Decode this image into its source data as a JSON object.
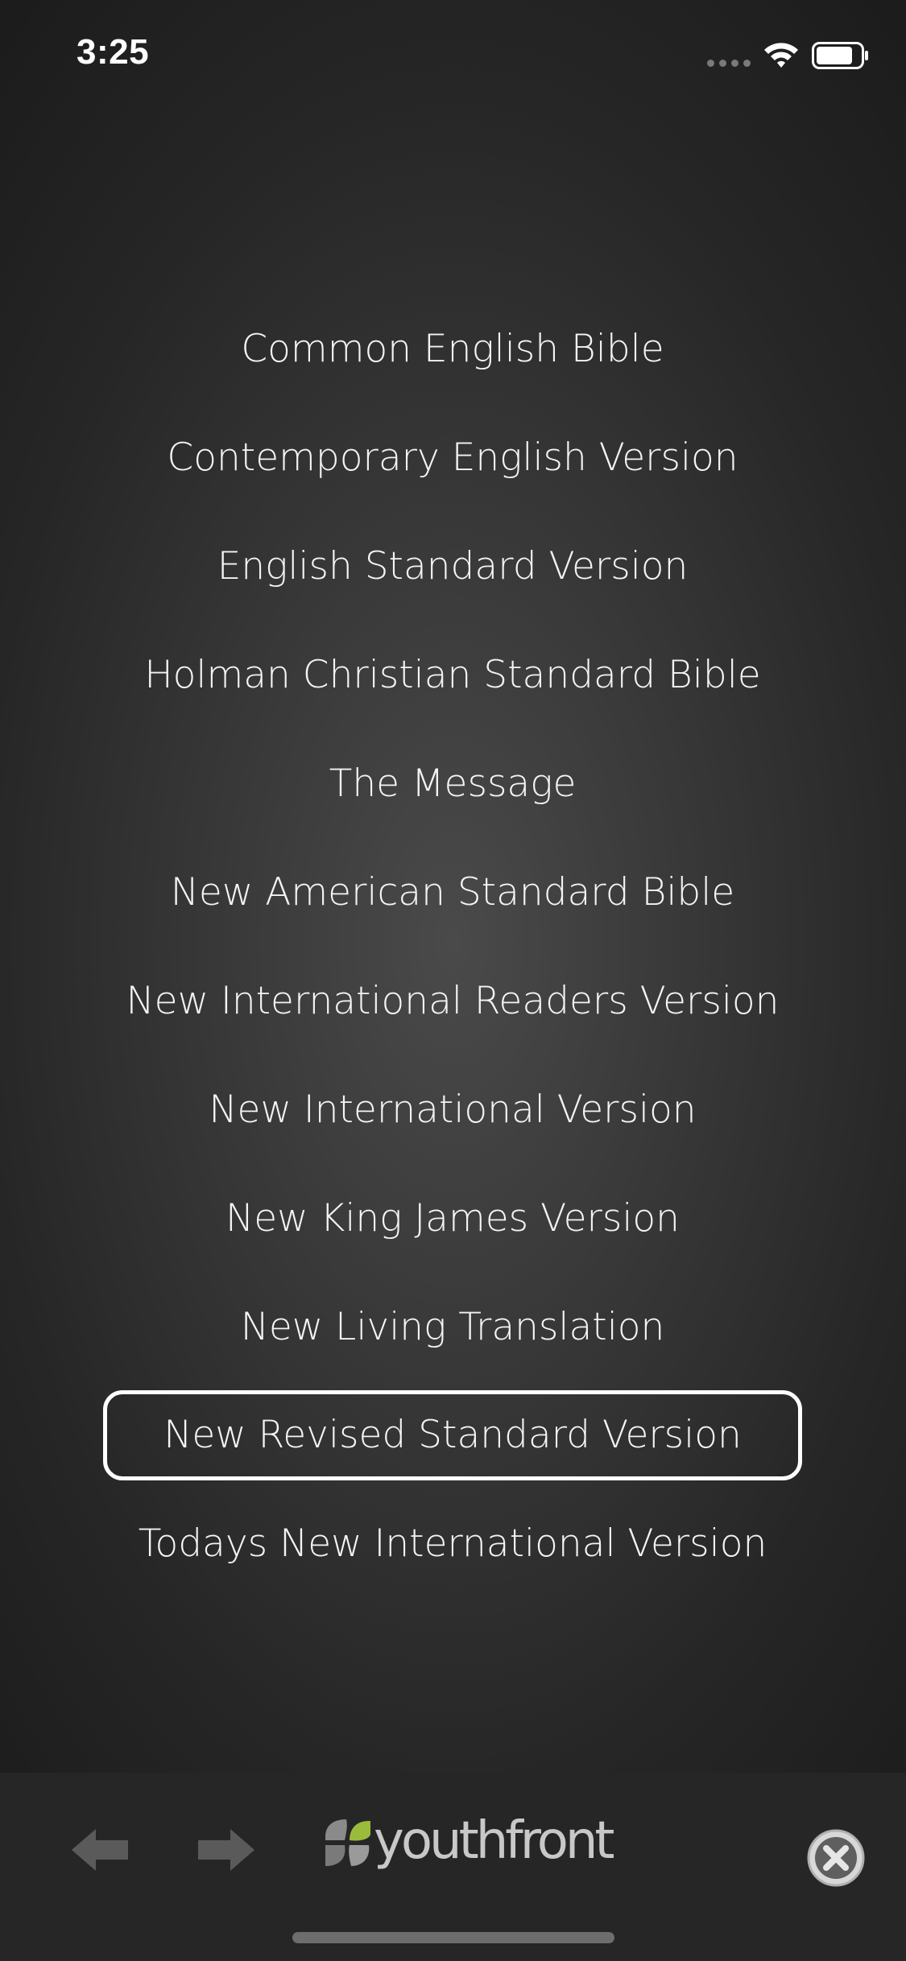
{
  "status_bar": {
    "time": "3:25"
  },
  "versions": {
    "items": [
      {
        "label": "Common English Bible"
      },
      {
        "label": "Contemporary English Version"
      },
      {
        "label": "English Standard Version"
      },
      {
        "label": "Holman Christian Standard Bible"
      },
      {
        "label": "The Message"
      },
      {
        "label": "New American Standard Bible"
      },
      {
        "label": "New International Readers Version"
      },
      {
        "label": "New International Version"
      },
      {
        "label": "New King James Version"
      },
      {
        "label": "New Living Translation"
      },
      {
        "label": "New Revised Standard Version"
      },
      {
        "label": "Todays New International Version"
      }
    ],
    "selected_label": "New Revised Standard Version"
  },
  "toolbar": {
    "logo_text": "youthfront",
    "icons": {
      "back": "arrow-left-icon",
      "forward": "arrow-right-icon",
      "close": "close-circle-icon"
    }
  },
  "colors": {
    "text": "#f4f4f4",
    "toolbar_background": "#262626",
    "disabled_icon": "#5a5a5a",
    "logo_green": "#9bbb3c",
    "logo_gray": "#8a8a8a"
  }
}
